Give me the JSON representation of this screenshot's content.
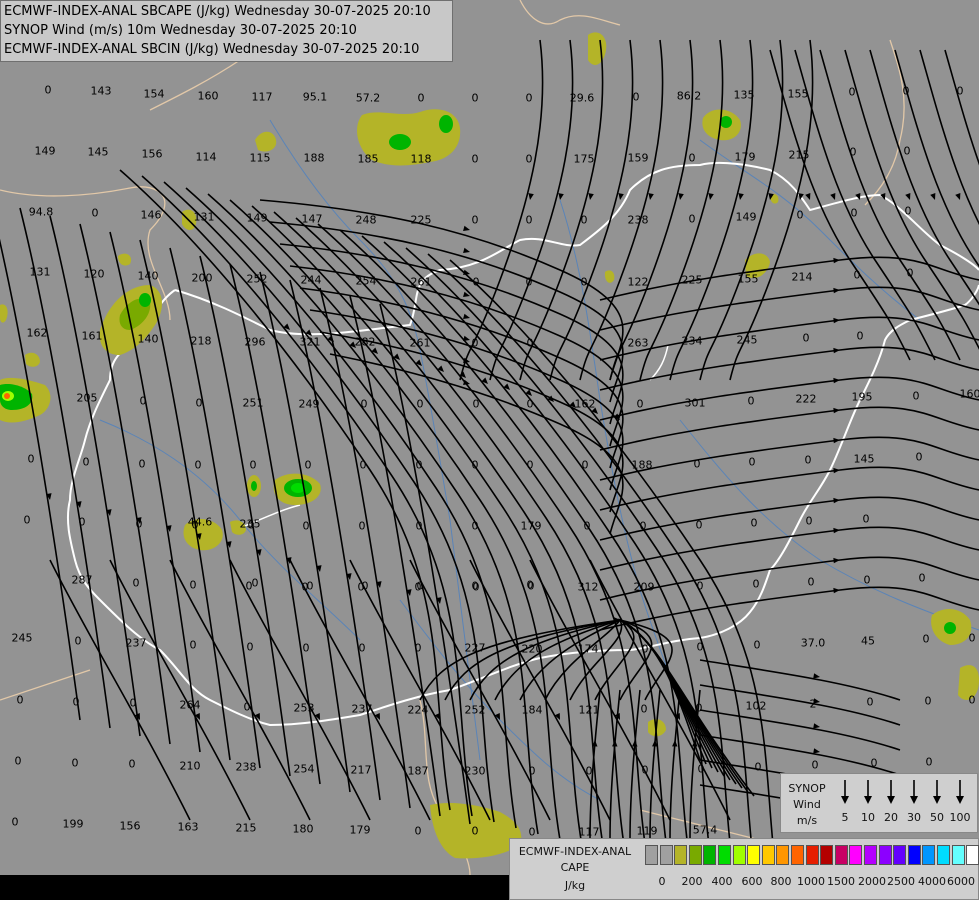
{
  "header": {
    "line1": "ECMWF-INDEX-ANAL SBCAPE (J/kg) Wednesday 30-07-2025 20:10",
    "line2": "SYNOP Wind (m/s) 10m Wednesday 30-07-2025 20:10",
    "line3": "ECMWF-INDEX-ANAL SBCIN (J/kg) Wednesday 30-07-2025 20:10"
  },
  "colors": {
    "background": "#939393",
    "border": "#e2c8a8",
    "country_border": "#ffffff",
    "river": "#5a84b8",
    "streamline": "#000000"
  },
  "cin_values": [
    "0",
    "143",
    "154",
    "160",
    "117",
    "95.1",
    "57.2",
    "0",
    "0",
    "0",
    "29.6",
    "0",
    "86.2",
    "135",
    "155",
    "0",
    "0",
    "0",
    "149",
    "145",
    "156",
    "114",
    "115",
    "188",
    "185",
    "118",
    "0",
    "0",
    "175",
    "159",
    "0",
    "179",
    "215",
    "0",
    "0",
    "94.8",
    "0",
    "146",
    "131",
    "149",
    "147",
    "248",
    "225",
    "0",
    "0",
    "0",
    "238",
    "0",
    "149",
    "0",
    "0",
    "0",
    "131",
    "120",
    "140",
    "200",
    "252",
    "244",
    "254",
    "261",
    "0",
    "0",
    "0",
    "122",
    "225",
    "155",
    "214",
    "0",
    "0",
    "162",
    "161",
    "140",
    "218",
    "296",
    "321",
    "282",
    "261",
    "0",
    "0",
    "263",
    "234",
    "245",
    "0",
    "0",
    "205",
    "0",
    "0",
    "251",
    "249",
    "0",
    "0",
    "0",
    "0",
    "162",
    "0",
    "301",
    "0",
    "222",
    "195",
    "0",
    "160",
    "0",
    "0",
    "0",
    "0",
    "0",
    "0",
    "0",
    "0",
    "0",
    "0",
    "0",
    "188",
    "0",
    "0",
    "0",
    "145",
    "0",
    "0",
    "0",
    "0",
    "0",
    "0",
    "0",
    "0",
    "0",
    "0",
    "179",
    "0",
    "0",
    "0",
    "0",
    "0",
    "0",
    "44.6",
    "235",
    "0",
    "0",
    "0",
    "0",
    "0",
    "0",
    "0",
    "287",
    "0",
    "0",
    "0",
    "0",
    "0",
    "0",
    "0",
    "312",
    "209",
    "0",
    "0",
    "0",
    "0",
    "0",
    "245",
    "0",
    "237",
    "0",
    "0",
    "0",
    "0",
    "0",
    "227",
    "220",
    "174",
    "0",
    "0",
    "0",
    "37.0",
    "45",
    "0",
    "0",
    "0",
    "0",
    "0",
    "264",
    "0",
    "253",
    "237",
    "224",
    "252",
    "184",
    "121",
    "0",
    "0",
    "102",
    "2",
    "0",
    "0",
    "0",
    "0",
    "0",
    "0",
    "210",
    "238",
    "254",
    "217",
    "187",
    "230",
    "0",
    "0",
    "0",
    "0",
    "0",
    "0",
    "0",
    "0",
    "0",
    "199",
    "156",
    "163",
    "215",
    "180",
    "179",
    "0",
    "0",
    "0",
    "117",
    "119",
    "57.4"
  ],
  "synop_legend": {
    "title": [
      "SYNOP",
      "Wind",
      "m/s"
    ],
    "values": [
      "5",
      "10",
      "20",
      "30",
      "50",
      "100"
    ]
  },
  "cape_legend": {
    "title": [
      "ECMWF-INDEX-ANAL",
      "CAPE",
      "J/kg"
    ],
    "colors": [
      "#a0a0a0",
      "#a0a0a0",
      "#b4b428",
      "#79aa00",
      "#00b400",
      "#00dc00",
      "#a0ff00",
      "#ffff00",
      "#ffc800",
      "#ff9600",
      "#ff6400",
      "#e61e00",
      "#b40000",
      "#c80064",
      "#ff00ff",
      "#b400ff",
      "#8c00ff",
      "#6400ff",
      "#0000ff",
      "#0096ff",
      "#00dcff",
      "#64ffff",
      "#ffffff"
    ],
    "ticks": [
      "0",
      "200",
      "400",
      "600",
      "800",
      "1000",
      "1500",
      "2000",
      "2500",
      "4000",
      "6000"
    ]
  }
}
